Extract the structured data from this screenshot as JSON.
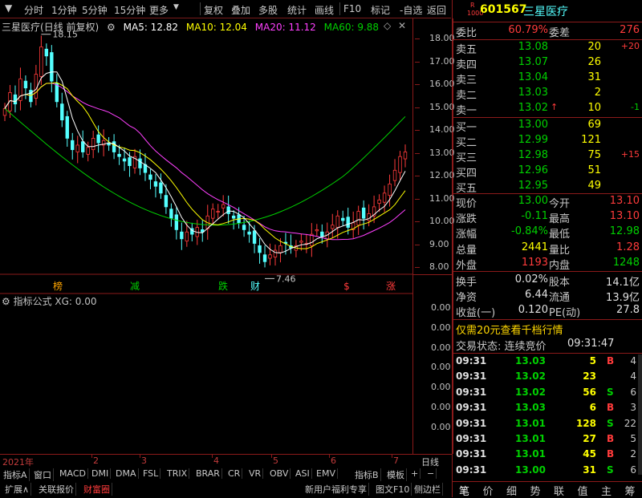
{
  "toolbar": {
    "items": [
      "分时",
      "1分钟",
      "5分钟",
      "15分钟",
      "更多",
      "复权",
      "叠加",
      "多股",
      "统计",
      "画线",
      "F10",
      "标记",
      "-自选",
      "返回"
    ]
  },
  "chart": {
    "stock_name": "三星医疗",
    "mode": "(日线 前复权)",
    "ma5": "MA5: 12.82",
    "ma10": "MA10: 12.04",
    "ma20": "MA20: 11.12",
    "ma60": "MA60: 9.88",
    "high_label": "18.15",
    "low_label": "7.46",
    "y_ticks": [
      "18.00",
      "17.00",
      "16.00",
      "15.00",
      "14.00",
      "13.00",
      "12.00",
      "11.00",
      "10.00",
      "9.00",
      "8.00"
    ],
    "markers": [
      "榜",
      "减",
      "跌",
      "财",
      "$",
      "涨"
    ],
    "colors": {
      "up": "#ff3b3b",
      "down": "#54ffff",
      "ma5": "#ffffff",
      "ma10": "#ffff00",
      "ma20": "#ff40ff",
      "ma60": "#00d000"
    }
  },
  "indicator": {
    "title": "指标公式 XG: 0.00",
    "ticks": [
      "0.00",
      "0.00",
      "0.00",
      "0.00",
      "0.00",
      "0.00",
      "0.00"
    ]
  },
  "date_axis": {
    "labels": [
      "2021年",
      "2",
      "3",
      "4",
      "5",
      "6",
      "7"
    ],
    "right_label": "日线"
  },
  "tabs1": [
    "指标A",
    "窗口",
    "MACD",
    "DMI",
    "DMA",
    "FSL",
    "TRIX",
    "BRAR",
    "CR",
    "VR",
    "OBV",
    "ASI",
    "EMV",
    "指标B",
    "模板",
    "+",
    "−"
  ],
  "tabs2": [
    "扩展∧",
    "关联报价",
    "财富圈",
    "新用户福利专享",
    "图文F10",
    "侧边栏"
  ],
  "quote": {
    "badge_top": "R",
    "badge_num": "1000",
    "code": "601567",
    "name": "三星医疗",
    "weibi_label": "委比",
    "weibi": "60.79%",
    "weicha_label": "委差",
    "weicha": "276",
    "asks": [
      {
        "label": "卖五",
        "price": "13.08",
        "vol": "20",
        "chg": "+20"
      },
      {
        "label": "卖四",
        "price": "13.07",
        "vol": "26",
        "chg": ""
      },
      {
        "label": "卖三",
        "price": "13.04",
        "vol": "31",
        "chg": ""
      },
      {
        "label": "卖二",
        "price": "13.03",
        "vol": "2",
        "chg": ""
      },
      {
        "label": "卖一",
        "price": "13.02",
        "vol": "10",
        "chg": "-1"
      }
    ],
    "bids": [
      {
        "label": "买一",
        "price": "13.00",
        "vol": "69",
        "chg": ""
      },
      {
        "label": "买二",
        "price": "12.99",
        "vol": "121",
        "chg": ""
      },
      {
        "label": "买三",
        "price": "12.98",
        "vol": "75",
        "chg": "+15"
      },
      {
        "label": "买四",
        "price": "12.96",
        "vol": "51",
        "chg": ""
      },
      {
        "label": "买五",
        "price": "12.95",
        "vol": "49",
        "chg": ""
      }
    ],
    "stats": [
      {
        "l1": "现价",
        "v1": "13.00",
        "l2": "今开",
        "v2": "13.10"
      },
      {
        "l1": "涨跌",
        "v1": "-0.11",
        "l2": "最高",
        "v2": "13.10"
      },
      {
        "l1": "涨幅",
        "v1": "-0.84%",
        "l2": "最低",
        "v2": "12.98"
      },
      {
        "l1": "总量",
        "v1": "2441",
        "l2": "量比",
        "v2": "1.28"
      },
      {
        "l1": "外盘",
        "v1": "1193",
        "l2": "内盘",
        "v2": "1248"
      }
    ],
    "stats2": [
      {
        "l1": "换手",
        "v1": "0.02%",
        "l2": "股本",
        "v2": "14.1亿"
      },
      {
        "l1": "净资",
        "v1": "6.44",
        "l2": "流通",
        "v2": "13.9亿"
      },
      {
        "l1": "收益(一)",
        "v1": "0.120",
        "l2": "PE(动)",
        "v2": "27.8"
      }
    ],
    "promo": "仅需20元查看千档行情",
    "status_label": "交易状态: 连续竞价",
    "status_time": "09:31:47",
    "ticks": [
      {
        "t": "09:31",
        "p": "13.03",
        "v": "5",
        "d": "B",
        "n": "4"
      },
      {
        "t": "09:31",
        "p": "13.02",
        "v": "23",
        "d": "",
        "n": "4"
      },
      {
        "t": "09:31",
        "p": "13.02",
        "v": "56",
        "d": "S",
        "n": "6"
      },
      {
        "t": "09:31",
        "p": "13.03",
        "v": "6",
        "d": "B",
        "n": "3"
      },
      {
        "t": "09:31",
        "p": "13.01",
        "v": "128",
        "d": "S",
        "n": "22"
      },
      {
        "t": "09:31",
        "p": "13.01",
        "v": "27",
        "d": "B",
        "n": "5"
      },
      {
        "t": "09:31",
        "p": "13.01",
        "v": "45",
        "d": "B",
        "n": "2"
      },
      {
        "t": "09:31",
        "p": "13.00",
        "v": "31",
        "d": "S",
        "n": "6"
      }
    ],
    "nav": [
      "笔",
      "价",
      "细",
      "势",
      "联",
      "值",
      "主",
      "筹"
    ]
  }
}
